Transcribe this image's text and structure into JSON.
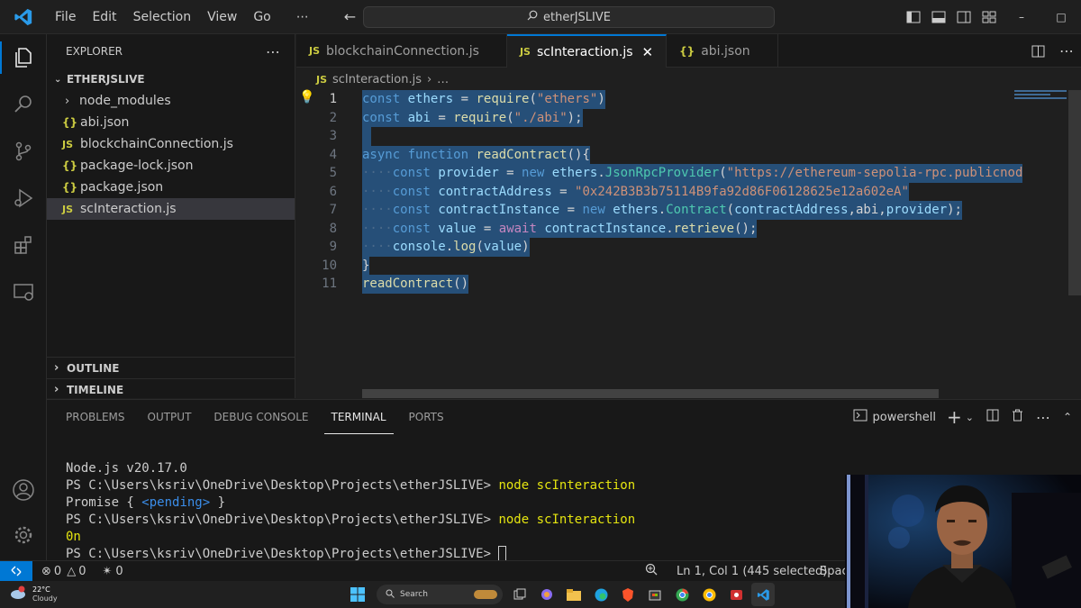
{
  "titlebar": {
    "menu": [
      "File",
      "Edit",
      "Selection",
      "View",
      "Go",
      "⋯"
    ],
    "search_text": "etherJSLIVE"
  },
  "explorer": {
    "title": "EXPLORER",
    "root": "ETHERJSLIVE",
    "items": [
      {
        "label": "node_modules",
        "kind": "folder"
      },
      {
        "label": "abi.json",
        "kind": "json"
      },
      {
        "label": "blockchainConnection.js",
        "kind": "js"
      },
      {
        "label": "package-lock.json",
        "kind": "json"
      },
      {
        "label": "package.json",
        "kind": "json"
      },
      {
        "label": "scInteraction.js",
        "kind": "js"
      }
    ],
    "outline": "OUTLINE",
    "timeline": "TIMELINE"
  },
  "tabs": [
    {
      "label": "blockchainConnection.js",
      "kind": "js"
    },
    {
      "label": "scInteraction.js",
      "kind": "js"
    },
    {
      "label": "abi.json",
      "kind": "json"
    }
  ],
  "breadcrumb": {
    "file": "scInteraction.js",
    "more": "…"
  },
  "code": {
    "line_numbers": [
      "1",
      "2",
      "3",
      "4",
      "5",
      "6",
      "7",
      "8",
      "9",
      "10",
      "11"
    ],
    "l1_a": "const",
    "l1_b": "ethers",
    "l1_c": " = ",
    "l1_d": "require",
    "l1_e": "(",
    "l1_f": "\"ethers\"",
    "l1_g": ")",
    "l2_a": "const",
    "l2_b": "abi",
    "l2_c": " = ",
    "l2_d": "require",
    "l2_e": "(",
    "l2_f": "\"./abi\"",
    "l2_g": ");",
    "l4_a": "async",
    "l4_b": "function",
    "l4_c": "readContract",
    "l4_d": "(){",
    "l5_a": "const",
    "l5_b": "provider",
    "l5_c": " = ",
    "l5_d": "new",
    "l5_e": "ethers",
    "l5_f": ".",
    "l5_g": "JsonRpcProvider",
    "l5_h": "(",
    "l5_i": "\"https://ethereum-sepolia-rpc.publicnod",
    "l6_a": "const",
    "l6_b": "contractAddress",
    "l6_c": " = ",
    "l6_d": "\"0x242B3B3b75114B9fa92d86F06128625e12a602eA\"",
    "l7_a": "const",
    "l7_b": "contractInstance",
    "l7_c": " = ",
    "l7_d": "new",
    "l7_e": "ethers",
    "l7_f": ".",
    "l7_g": "Contract",
    "l7_h": "(",
    "l7_i": "contractAddress",
    "l7_j": ",abi,",
    "l7_k": "provider",
    "l7_l": ");",
    "l8_a": "const",
    "l8_b": "value",
    "l8_c": " = ",
    "l8_d": "await",
    "l8_e": "contractInstance",
    "l8_f": ".",
    "l8_g": "retrieve",
    "l8_h": "();",
    "l9_a": "console",
    "l9_b": ".",
    "l9_c": "log",
    "l9_d": "(",
    "l9_e": "value",
    "l9_f": ")",
    "l10": "}",
    "l11_a": "readContract",
    "l11_b": "()"
  },
  "panel": {
    "tabs": [
      "PROBLEMS",
      "OUTPUT",
      "DEBUG CONSOLE",
      "TERMINAL",
      "PORTS"
    ],
    "shell": "powershell",
    "terminal": {
      "line1": "Node.js v20.17.0",
      "prompt": "PS C:\\Users\\ksriv\\OneDrive\\Desktop\\Projects\\etherJSLIVE>",
      "cmd": " node scInteraction",
      "promise_a": "Promise { ",
      "promise_b": "<pending>",
      "promise_c": " }",
      "result": "0n"
    }
  },
  "statusbar": {
    "errors": "0",
    "warnings": "0",
    "ports": "0",
    "position": "Ln 1, Col 1 (445 selected)",
    "spaces": "Spac"
  },
  "taskbar": {
    "weather_temp": "22°C",
    "weather_desc": "Cloudy",
    "search": "Search"
  },
  "colors": {
    "accent": "#0078d4",
    "selection": "#264f78"
  }
}
